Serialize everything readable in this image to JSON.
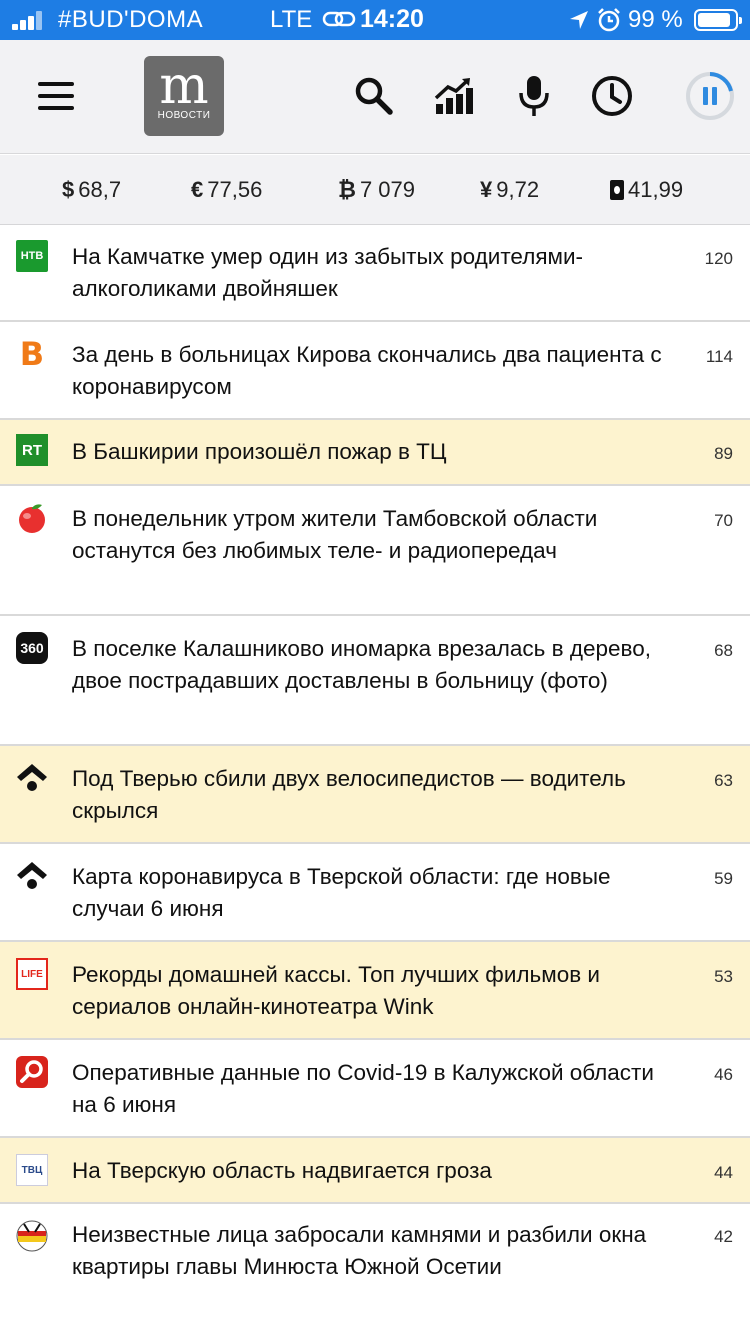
{
  "status_bar": {
    "carrier": "#BUD'DOMA",
    "network": "LTE",
    "time": "14:20",
    "battery": "99 %"
  },
  "header": {
    "logo_letter": "m",
    "logo_caption": "НОВОСТИ",
    "icons": [
      "menu-icon",
      "search-icon",
      "trending-icon",
      "microphone-icon",
      "clock-icon",
      "pause-icon"
    ]
  },
  "rates": [
    {
      "symbol": "$",
      "value": "68,7"
    },
    {
      "symbol": "€",
      "value": "77,56"
    },
    {
      "symbol": "₿",
      "value": "7 079"
    },
    {
      "symbol": "¥",
      "value": "9,72"
    },
    {
      "symbol": "oil-barrel-icon",
      "value": "41,99"
    }
  ],
  "news": [
    {
      "source": "ntv",
      "title": "На Камчатке умер один из забытых родителями-алкоголиками двойняшек",
      "count": "120",
      "highlight": false
    },
    {
      "source": "v-letter",
      "title": "За день в больницах Кирова скончались два пациента с коронавирусом",
      "count": "114",
      "highlight": false
    },
    {
      "source": "rt",
      "title": "В Башкирии произошёл пожар в ТЦ",
      "count": "89",
      "highlight": true
    },
    {
      "source": "apple",
      "title": "В понедельник утром жители Тамбовской области останутся без любимых теле- и радиопередач",
      "count": "70",
      "highlight": false
    },
    {
      "source": "360",
      "title": "В поселке Калашниково иномарка врезалась в дерево, двое пострадавших доставлены в больницу (фото)",
      "count": "68",
      "highlight": false
    },
    {
      "source": "diamond-dot",
      "title": "Под Тверью сбили двух велосипедистов — водитель скрылся",
      "count": "63",
      "highlight": true
    },
    {
      "source": "diamond-dot",
      "title": "Карта коронавируса в Тверской области: где новые случаи 6 июня",
      "count": "59",
      "highlight": false
    },
    {
      "source": "life",
      "title": "Рекорды домашней кассы. Топ лучших фильмов и сериалов онлайн-кинотеатра Wink",
      "count": "53",
      "highlight": true
    },
    {
      "source": "magnifier-red",
      "title": "Оперативные данные по Covid-19 в Калужской области на 6 июня",
      "count": "46",
      "highlight": false
    },
    {
      "source": "tvc",
      "title": "На Тверскую область надвигается гроза",
      "count": "44",
      "highlight": true
    },
    {
      "source": "flag-round",
      "title": "Неизвестные лица забросали камнями и разбили окна квартиры главы Минюста Южной Осетии",
      "count": "42",
      "highlight": false
    }
  ],
  "badge_text": {
    "ntv": "НТВ",
    "v": "В",
    "rt": "RT",
    "n360": "360",
    "life": "LIFE",
    "tvc": "ТВЦ"
  },
  "colors": {
    "status_bar": "#1e7de4",
    "highlight_row": "#fdf3cf",
    "header_bg": "#f2f2f4",
    "pause_ring": "#2f8be0"
  }
}
